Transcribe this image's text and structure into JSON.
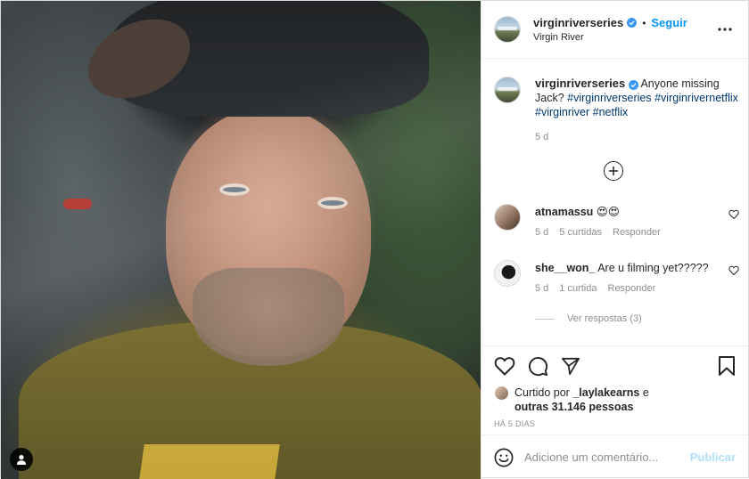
{
  "post": {
    "author": "virginriverseries",
    "follow_label": "Seguir",
    "location": "Virgin River",
    "caption_text": "Anyone missing Jack?",
    "hashtags": [
      "#virginriverseries",
      "#virginrivernetflix",
      "#virginriver",
      "#netflix"
    ],
    "caption_age": "5 d"
  },
  "comments": [
    {
      "user": "atnamassu",
      "text": "😍😍",
      "age": "5 d",
      "likes": "5 curtidas",
      "reply_label": "Responder"
    },
    {
      "user": "she__won_",
      "text": "Are u filming yet?????",
      "age": "5 d",
      "likes": "1 curtida",
      "reply_label": "Responder",
      "view_replies": "Ver respostas (3)"
    }
  ],
  "likes": {
    "prefix": "Curtido por",
    "user": "_laylakearns",
    "joiner": "e",
    "others": "outras 31.146 pessoas"
  },
  "timestamp": "HÁ 5 DIAS",
  "add_comment": {
    "placeholder": "Adicione um comentário...",
    "publish_label": "Publicar"
  },
  "icons": {
    "verified": "verified-badge-icon",
    "more": "more-options-icon",
    "load_more": "plus-circle-icon",
    "like": "heart-icon",
    "comment": "comment-bubble-icon",
    "share": "paper-plane-icon",
    "save": "bookmark-icon",
    "emoji": "smiley-icon",
    "tag": "user-tag-icon"
  },
  "colors": {
    "link": "#0095f6",
    "hashtag": "#00376b",
    "muted": "#8e8e8e",
    "publish_disabled": "#b2dffc"
  }
}
